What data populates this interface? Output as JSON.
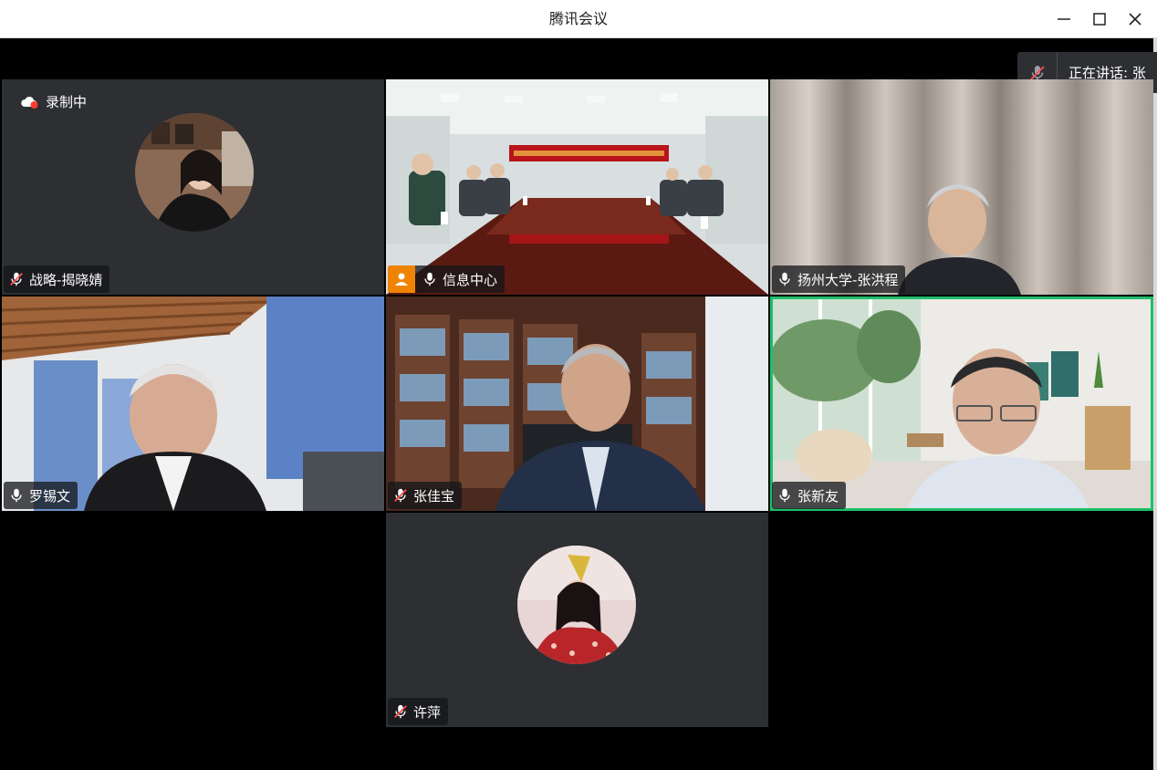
{
  "window": {
    "title": "腾讯会议",
    "minimize_icon": "minimize-icon",
    "maximize_icon": "maximize-icon",
    "close_icon": "close-icon"
  },
  "speaking": {
    "icon": "mic-muted-icon",
    "label": "正在讲话:  张"
  },
  "recording": {
    "icon": "cloud-record-icon",
    "label": "录制中"
  },
  "participants": [
    {
      "name": "战略-揭晓婧",
      "mic": "muted",
      "view": "avatar"
    },
    {
      "name": "信息中心",
      "mic": "on",
      "view": "video",
      "host": true
    },
    {
      "name": "扬州大学-张洪程",
      "mic": "on",
      "view": "video"
    },
    {
      "name": "罗锡文",
      "mic": "on",
      "view": "video"
    },
    {
      "name": "张佳宝",
      "mic": "muted",
      "view": "video"
    },
    {
      "name": "张新友",
      "mic": "on",
      "view": "video",
      "active_speaker": true
    },
    {
      "name": "许萍",
      "mic": "muted",
      "view": "avatar"
    }
  ],
  "colors": {
    "tile_bg": "#2d2f33",
    "active_border": "#1fbf6a",
    "host_badge": "#f08300",
    "record_dot": "#ff3b30"
  }
}
